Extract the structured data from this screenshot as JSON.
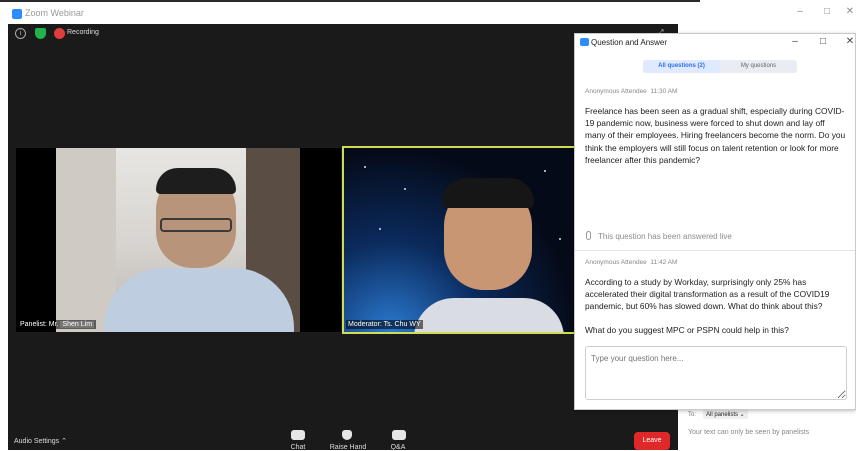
{
  "window": {
    "title": "Zoom Webinar",
    "minimize": "–",
    "maximize": "□",
    "close": "✕"
  },
  "status": {
    "recording_label": "Recording"
  },
  "videos": {
    "left": {
      "label_prefix": "Panelist: Mr.",
      "label_name": "Shen Lim"
    },
    "right": {
      "label": "Moderator: Ts. Chu WY"
    }
  },
  "toolbar": {
    "audio_settings": "Audio Settings ⌃",
    "chat": "Chat",
    "raise_hand": "Raise Hand",
    "qa": "Q&A",
    "leave": "Leave"
  },
  "qa_window": {
    "title": "Question and Answer",
    "minimize": "–",
    "maximize": "□",
    "close": "✕",
    "tabs": [
      {
        "label": "All questions (2)",
        "active": true
      },
      {
        "label": "My questions",
        "active": false
      }
    ],
    "questions": [
      {
        "author": "Anonymous Attendee",
        "time": "11:30 AM",
        "text": "Freelance has been seen as a gradual shift, especially during COVID-19 pandemic now, business were forced to shut down and lay off many of their employees. Hiring freelancers become the norm. Do you think the employers will still focus on talent retention or look for more freelancer after this pandemic?",
        "status": "This question has been answered live"
      },
      {
        "author": "Anonymous Attendee",
        "time": "11:42 AM",
        "text": "According to a study by Workday, surprisingly only 25% has accelerated their digital transformation as a result of the COVID19 pandemic, but 60% has slowed down. What do think about this?",
        "text2": "What do you suggest MPC or PSPN could help in this?"
      }
    ],
    "input_placeholder": "Type your question here..."
  },
  "chat": {
    "to_label": "To:",
    "to_value": "All panelists ⌄",
    "note": "Your text can only be seen by panelists"
  },
  "colors": {
    "accent": "#2d8cff",
    "leave": "#e02828",
    "speaker_border": "#cfdd55"
  }
}
